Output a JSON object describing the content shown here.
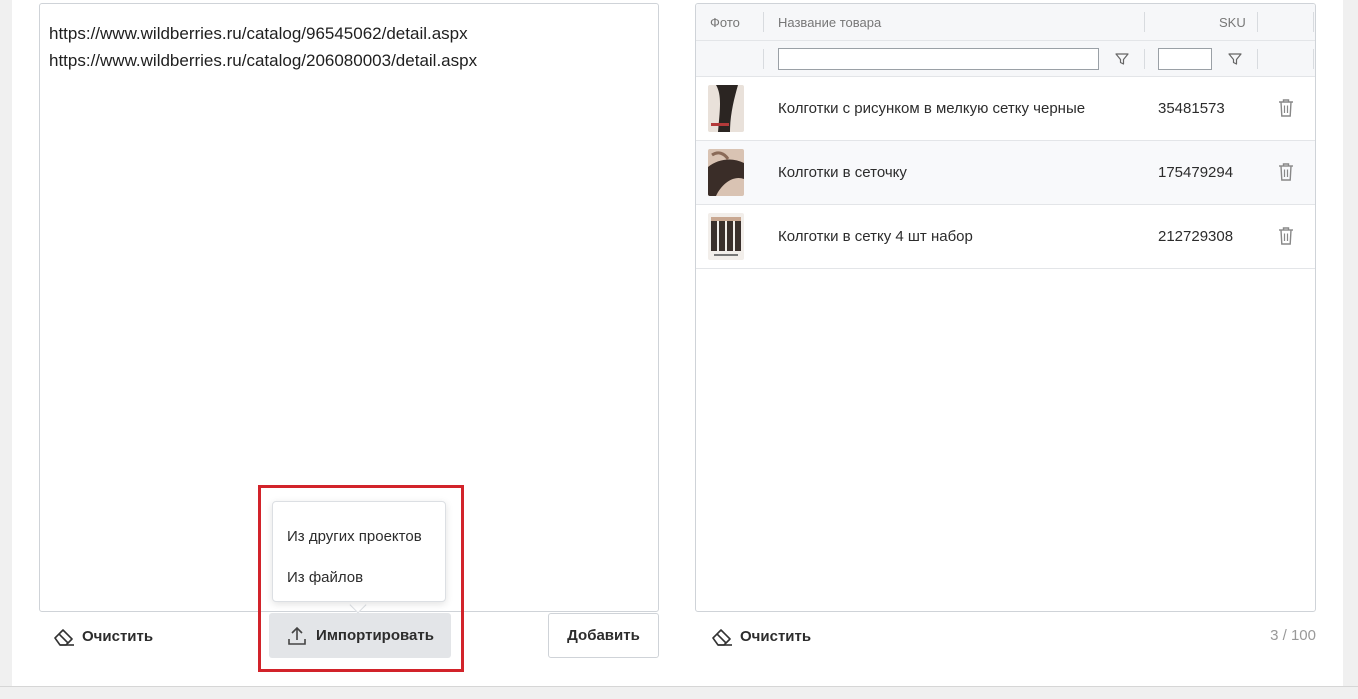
{
  "left_panel": {
    "urls": [
      "https://www.wildberries.ru/catalog/96545062/detail.aspx",
      "https://www.wildberries.ru/catalog/206080003/detail.aspx"
    ],
    "clear_label": "Очистить",
    "import_label": "Импортировать",
    "add_label": "Добавить",
    "import_menu": {
      "items": [
        "Из других проектов",
        "Из файлов"
      ]
    }
  },
  "right_panel": {
    "columns": {
      "photo": "Фото",
      "name": "Название товара",
      "sku": "SKU"
    },
    "filters": {
      "name_value": "",
      "sku_value": ""
    },
    "rows": [
      {
        "name": "Колготки с рисунком в мелкую сетку черные",
        "sku": "35481573"
      },
      {
        "name": "Колготки в сеточку",
        "sku": "175479294"
      },
      {
        "name": "Колготки в сетку 4 шт набор",
        "sku": "212729308"
      }
    ],
    "clear_label": "Очистить",
    "counter": "3 / 100"
  },
  "colors": {
    "highlight": "#d2232a",
    "import_button_bg": "#e3e5e8",
    "border": "#cfd3d8"
  },
  "icons": {
    "clear": "eraser-icon",
    "import": "upload-icon",
    "filter": "funnel-icon",
    "delete": "trash-icon"
  }
}
